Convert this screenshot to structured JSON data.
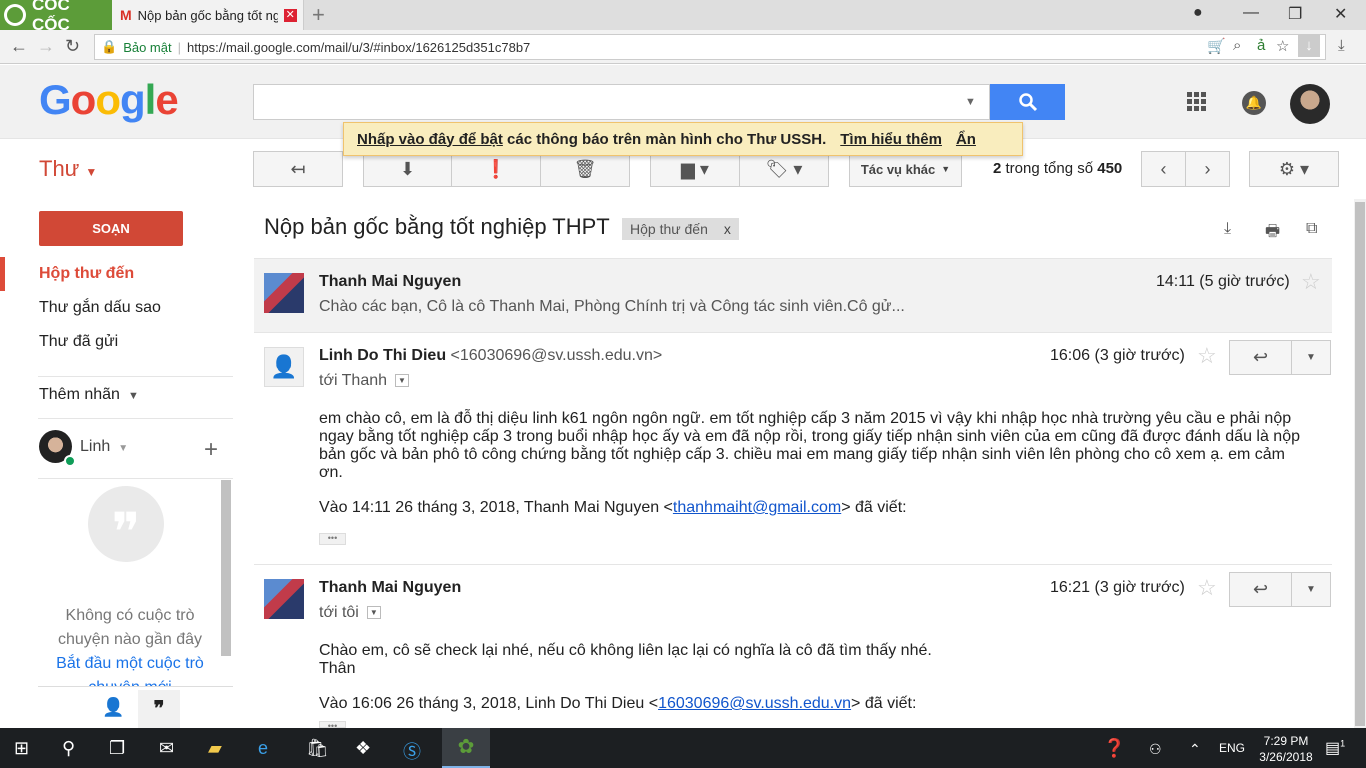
{
  "browser": {
    "logo_text": "CỐC CỐC",
    "tab_title": "Nộp bản gốc bằng tốt nghiệp THPT",
    "tab_close": "✕",
    "new_tab": "+",
    "secure_label": "Bảo mật",
    "url": "https://mail.google.com/mail/u/3/#inbox/1626125d351c78b7"
  },
  "gmail": {
    "logo_letters": [
      "G",
      "o",
      "o",
      "g",
      "l",
      "e"
    ],
    "search_placeholder": "",
    "notification": {
      "text_link": "Nhấp vào đây để bật",
      "text_rest": " các thông báo trên màn hình cho Thư USSH.",
      "learn_more": "Tìm hiểu thêm",
      "dismiss": "Ẩn"
    },
    "app_label": "Thư",
    "toolbar": {
      "more_actions": "Tác vụ khác",
      "paging_current": "2",
      "paging_mid": " trong tổng số ",
      "paging_total": "450"
    }
  },
  "sidebar": {
    "compose": "SOẠN",
    "items": [
      {
        "label": "Hộp thư đến"
      },
      {
        "label": "Thư gắn dấu sao"
      },
      {
        "label": "Thư đã gửi"
      }
    ],
    "more_labels": "Thêm nhãn",
    "hangouts_user": "Linh",
    "hangouts_empty_1": "Không có cuộc trò",
    "hangouts_empty_2": "chuyện nào gần đây",
    "hangouts_start_1": "Bắt đầu một cuộc trò",
    "hangouts_start_2": "chuyện mới"
  },
  "thread": {
    "subject": "Nộp bản gốc bằng tốt nghiệp THPT",
    "label": "Hộp thư đến",
    "label_remove": "x",
    "messages": [
      {
        "sender": "Thanh Mai Nguyen",
        "time": "14:11 (5 giờ trước)",
        "snippet": "Chào các bạn, Cô là cô Thanh Mai, Phòng Chính trị và Công tác sinh viên.Cô gử..."
      },
      {
        "sender": "Linh Do Thi Dieu",
        "email": " <16030696@sv.ussh.edu.vn>",
        "time": "16:06 (3 giờ trước)",
        "to": "tới Thanh",
        "body": "em chào cô, em là đỗ thị diệu linh k61 ngôn ngôn ngữ. em tốt nghiệp cấp 3 năm 2015 vì vậy khi nhập học nhà trường yêu cầu e phải nộp ngay bằng tốt nghiệp cấp 3 trong buổi nhập học ấy và em đã nộp rồi, trong giấy tiếp nhận sinh viên của em cũng đã được đánh dấu là nộp bản gốc và bản phô tô công chứng bằng tốt nghiệp cấp 3. chiều mai em mang giấy tiếp nhận sinh viên lên phòng cho cô xem ạ. em cảm ơn.",
        "quote_prefix": "Vào 14:11 26 tháng 3, 2018, Thanh Mai Nguyen <",
        "quote_email": "thanhmaiht@gmail.com",
        "quote_suffix": "> đã viết:",
        "ellipsis": "•••"
      },
      {
        "sender": "Thanh Mai Nguyen",
        "time": "16:21 (3 giờ trước)",
        "to": "tới tôi",
        "body_line1": "Chào em, cô sẽ check lại nhé, nếu cô không liên lạc lại có nghĩa là cô đã tìm thấy nhé.",
        "body_line2": "Thân",
        "quote_prefix": "Vào 16:06 26 tháng 3, 2018, Linh Do Thi Dieu <",
        "quote_email": "16030696@sv.ussh.edu.vn",
        "quote_suffix": "> đã viết:",
        "ellipsis": "•••"
      }
    ]
  },
  "taskbar": {
    "language": "ENG",
    "time": "7:29 PM",
    "date": "3/26/2018",
    "notifications": "1"
  }
}
